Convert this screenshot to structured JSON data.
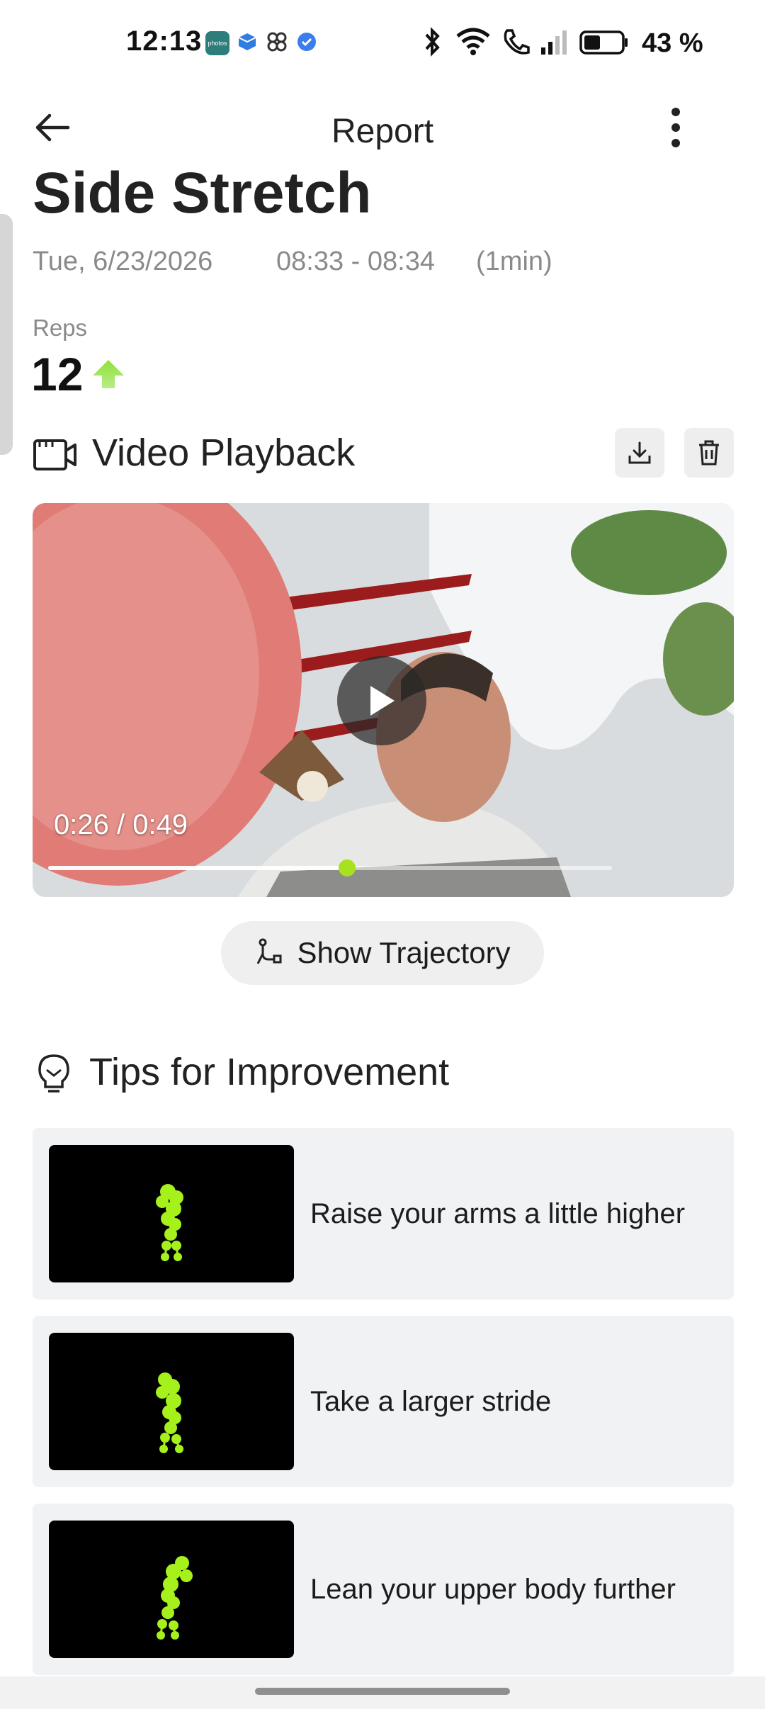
{
  "status_bar": {
    "time": "12:13",
    "app_icons": [
      "photos-icon",
      "box-icon",
      "pinwheel-icon",
      "verified-icon"
    ],
    "photos_icon_label": "photos",
    "indicators": [
      "bluetooth-icon",
      "wifi-icon",
      "call-icon",
      "signal-icon",
      "battery-icon"
    ],
    "battery_percent": "43 %",
    "battery_level": 0.43
  },
  "app_bar": {
    "title": "Report",
    "back_icon": "arrow-left-icon",
    "more_icon": "more-vertical-icon"
  },
  "session": {
    "exercise_name": "Side Stretch",
    "date": "Tue, 6/23/2026",
    "time_range": "08:33 - 08:34",
    "duration": "(1min)",
    "reps_label": "Reps",
    "reps_value": "12",
    "trend_icon": "arrow-up-icon",
    "trend_color": "#7ed321"
  },
  "video_section": {
    "title": "Video Playback",
    "section_icon": "video-camera-icon",
    "download_icon": "download-icon",
    "delete_icon": "trash-icon",
    "current_time": "0:26 / 0:49",
    "progress": 0.53,
    "play_icon": "play-icon",
    "thumb_color": "#a8e21f"
  },
  "trajectory_button": {
    "label": "Show Trajectory",
    "icon": "trajectory-icon"
  },
  "tips_section": {
    "title": "Tips for Improvement",
    "icon": "lightbulb-icon",
    "tips": [
      {
        "text": "Raise your arms a little higher"
      },
      {
        "text": "Take a larger stride"
      },
      {
        "text": "Lean your upper body further"
      }
    ],
    "figure_color": "#a6f01c"
  }
}
